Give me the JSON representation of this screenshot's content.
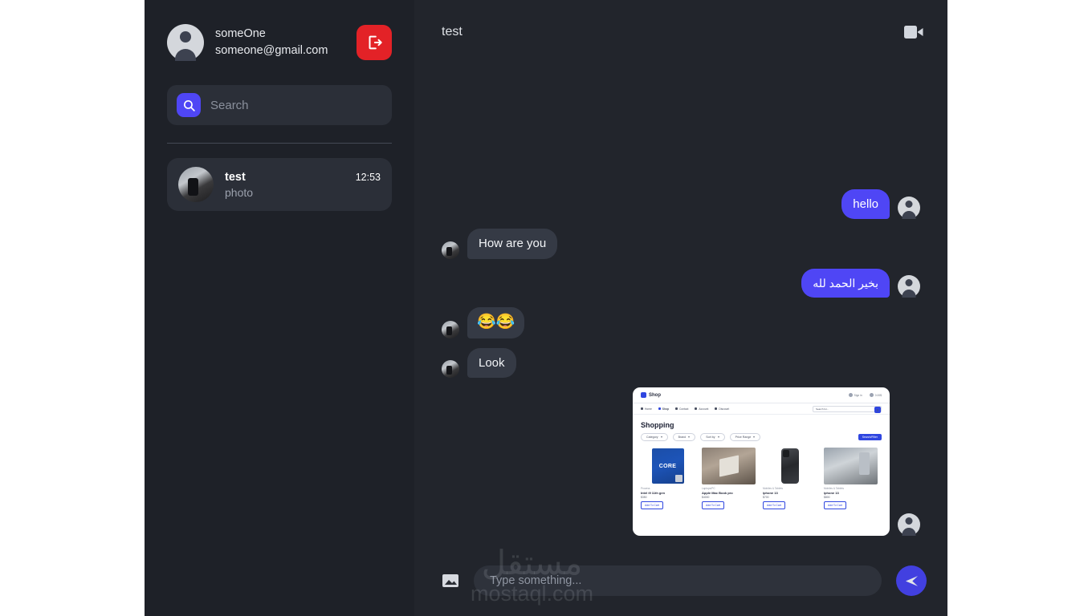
{
  "colors": {
    "sidebar_bg": "#1e2128",
    "chat_bg": "#22252c",
    "accent_blue": "#4f46f5",
    "send_blue": "#4240e0",
    "logout_red": "#e32227",
    "bubble_in": "#353a45",
    "page_bg": "#ffffff"
  },
  "sidebar": {
    "profile": {
      "name": "someOne",
      "email": "someone@gmail.com",
      "avatar_icon": "person-avatar-icon"
    },
    "logout": {
      "label": "",
      "icon": "logout-icon"
    },
    "search": {
      "placeholder": "Search",
      "value": "",
      "icon": "search-icon"
    },
    "conversations": [
      {
        "name": "test",
        "time": "12:53",
        "preview": "photo",
        "avatar_icon": "contact-photo-avatar"
      }
    ]
  },
  "chat": {
    "header": {
      "title": "test",
      "video_call_icon": "video-camera-icon"
    },
    "messages": [
      {
        "id": "m1",
        "side": "out",
        "type": "text",
        "text": "hello"
      },
      {
        "id": "m2",
        "side": "in",
        "type": "text",
        "text": "How are you"
      },
      {
        "id": "m3",
        "side": "out",
        "type": "text",
        "text": "بخير الحمد لله",
        "rtl": true
      },
      {
        "id": "m4",
        "side": "in",
        "type": "emoji",
        "text": "😂😂"
      },
      {
        "id": "m5",
        "side": "in",
        "type": "text",
        "text": "Look"
      },
      {
        "id": "m6",
        "side": "out",
        "type": "image",
        "text": ""
      }
    ],
    "attachment": {
      "alt": "shop-website-screenshot",
      "brand": "Shop",
      "account_label": "Account",
      "signin_label": "Sign in",
      "cart_label": "Cart",
      "cart_count": "0.00$",
      "nav": [
        "Home",
        "Shop",
        "Contact",
        "Account",
        "Discount"
      ],
      "nav_active": "Shop",
      "page_title": "Shopping",
      "search_placeholder": "Search for...",
      "filters": [
        "Category",
        "Brand",
        "Sort by",
        "Price Range"
      ],
      "apply_label": "Search/Filter",
      "products": [
        {
          "category": "Process",
          "name": "Intel i9 11th gen",
          "price": "$350",
          "button": "Add To Cart",
          "image": "cpu-core-box"
        },
        {
          "category": "Laptops/PC",
          "name": "Apple Mac Book pro",
          "price": "$4000",
          "button": "Add To Cart",
          "image": "macbook-photo"
        },
        {
          "category": "Mobiles & Tablets",
          "name": "iphone 13",
          "price": "$700",
          "button": "Add To Cart",
          "image": "iphone-black"
        },
        {
          "category": "Mobiles & Tablets",
          "name": "iphone 13",
          "price": "$800",
          "button": "Add To Cart",
          "image": "iphone-silver"
        }
      ]
    },
    "input": {
      "placeholder": "Type something...",
      "value": "",
      "attach_icon": "image-attach-icon",
      "send_icon": "send-icon"
    }
  },
  "watermark": {
    "arabic": "مستقل",
    "latin": "mostaql.com"
  }
}
